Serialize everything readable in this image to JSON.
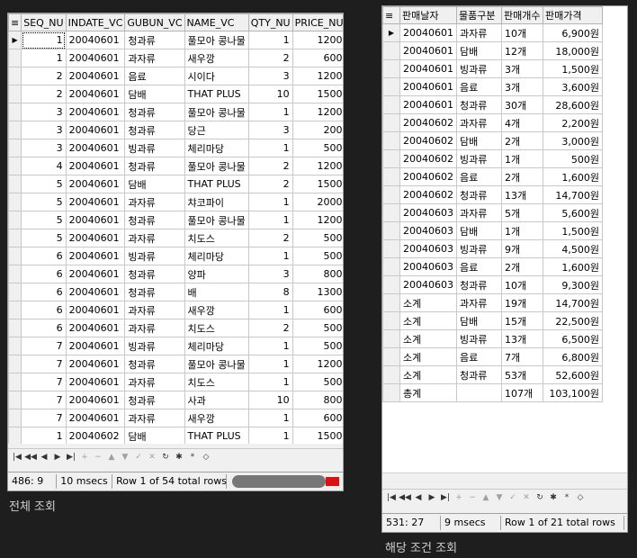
{
  "left": {
    "columns": [
      "SEQ_NU",
      "INDATE_VC",
      "GUBUN_VC",
      "NAME_VC",
      "QTY_NU",
      "PRICE_NU"
    ],
    "rows": [
      [
        "1",
        "20040601",
        "청과류",
        "풀모아 콩나물",
        "1",
        "1200"
      ],
      [
        "1",
        "20040601",
        "과자류",
        "새우깡",
        "2",
        "600"
      ],
      [
        "2",
        "20040601",
        "음료",
        "시이다",
        "3",
        "1200"
      ],
      [
        "2",
        "20040601",
        "담배",
        "THAT PLUS",
        "10",
        "1500"
      ],
      [
        "3",
        "20040601",
        "청과류",
        "풀모아 콩나물",
        "1",
        "1200"
      ],
      [
        "3",
        "20040601",
        "청과류",
        "당근",
        "3",
        "200"
      ],
      [
        "3",
        "20040601",
        "빙과류",
        "체리마당",
        "1",
        "500"
      ],
      [
        "4",
        "20040601",
        "청과류",
        "풀모아 콩나물",
        "2",
        "1200"
      ],
      [
        "5",
        "20040601",
        "담배",
        "THAT PLUS",
        "2",
        "1500"
      ],
      [
        "5",
        "20040601",
        "과자류",
        "챠코파이",
        "1",
        "2000"
      ],
      [
        "5",
        "20040601",
        "청과류",
        "풀모아 콩나물",
        "1",
        "1200"
      ],
      [
        "5",
        "20040601",
        "과자류",
        "치도스",
        "2",
        "500"
      ],
      [
        "6",
        "20040601",
        "빙과류",
        "체리마당",
        "1",
        "500"
      ],
      [
        "6",
        "20040601",
        "청과류",
        "양파",
        "3",
        "800"
      ],
      [
        "6",
        "20040601",
        "청과류",
        "배",
        "8",
        "1300"
      ],
      [
        "6",
        "20040601",
        "과자류",
        "새우깡",
        "1",
        "600"
      ],
      [
        "6",
        "20040601",
        "과자류",
        "치도스",
        "2",
        "500"
      ],
      [
        "7",
        "20040601",
        "빙과류",
        "체리마당",
        "1",
        "500"
      ],
      [
        "7",
        "20040601",
        "청과류",
        "풀모아 콩나물",
        "1",
        "1200"
      ],
      [
        "7",
        "20040601",
        "과자류",
        "치도스",
        "1",
        "500"
      ],
      [
        "7",
        "20040601",
        "청과류",
        "사과",
        "10",
        "800"
      ],
      [
        "7",
        "20040601",
        "과자류",
        "새우깡",
        "1",
        "600"
      ],
      [
        "1",
        "20040602",
        "담배",
        "THAT PLUS",
        "1",
        "1500"
      ]
    ],
    "status": {
      "position": "486:  9",
      "time": "10 msecs",
      "rows": "Row 1 of 54 total rows"
    },
    "caption": "전체 조회"
  },
  "right": {
    "columns": [
      "판매날자",
      "물품구분",
      "판매개수",
      "판매가격"
    ],
    "rows": [
      [
        "20040601",
        "과자류",
        "10개",
        "6,900원"
      ],
      [
        "20040601",
        "담배",
        "12개",
        "18,000원"
      ],
      [
        "20040601",
        "빙과류",
        "3개",
        "1,500원"
      ],
      [
        "20040601",
        "음료",
        "3개",
        "3,600원"
      ],
      [
        "20040601",
        "청과류",
        "30개",
        "28,600원"
      ],
      [
        "20040602",
        "과자류",
        "4개",
        "2,200원"
      ],
      [
        "20040602",
        "담배",
        "2개",
        "3,000원"
      ],
      [
        "20040602",
        "빙과류",
        "1개",
        "500원"
      ],
      [
        "20040602",
        "음료",
        "2개",
        "1,600원"
      ],
      [
        "20040602",
        "청과류",
        "13개",
        "14,700원"
      ],
      [
        "20040603",
        "과자류",
        "5개",
        "5,600원"
      ],
      [
        "20040603",
        "담배",
        "1개",
        "1,500원"
      ],
      [
        "20040603",
        "빙과류",
        "9개",
        "4,500원"
      ],
      [
        "20040603",
        "음료",
        "2개",
        "1,600원"
      ],
      [
        "20040603",
        "청과류",
        "10개",
        "9,300원"
      ],
      [
        "소계",
        "과자류",
        "19개",
        "14,700원"
      ],
      [
        "소계",
        "담배",
        "15개",
        "22,500원"
      ],
      [
        "소계",
        "빙과류",
        "13개",
        "6,500원"
      ],
      [
        "소계",
        "음료",
        "7개",
        "6,800원"
      ],
      [
        "소계",
        "청과류",
        "53개",
        "52,600원"
      ],
      [
        "총계",
        "",
        "107개",
        "103,100원"
      ]
    ],
    "status": {
      "position": "531:  27",
      "time": "9 msecs",
      "rows": "Row 1 of 21 total rows"
    },
    "caption": "해당 조건 조회"
  },
  "icons": {
    "nav": [
      "first-icon",
      "prev-page-icon",
      "prev-icon",
      "next-icon",
      "last-icon",
      "insert-icon",
      "delete-icon",
      "up-icon",
      "down-icon",
      "post-icon",
      "cancel-icon",
      "refresh-icon",
      "asterisk-icon",
      "star-icon",
      "filter-icon"
    ]
  }
}
